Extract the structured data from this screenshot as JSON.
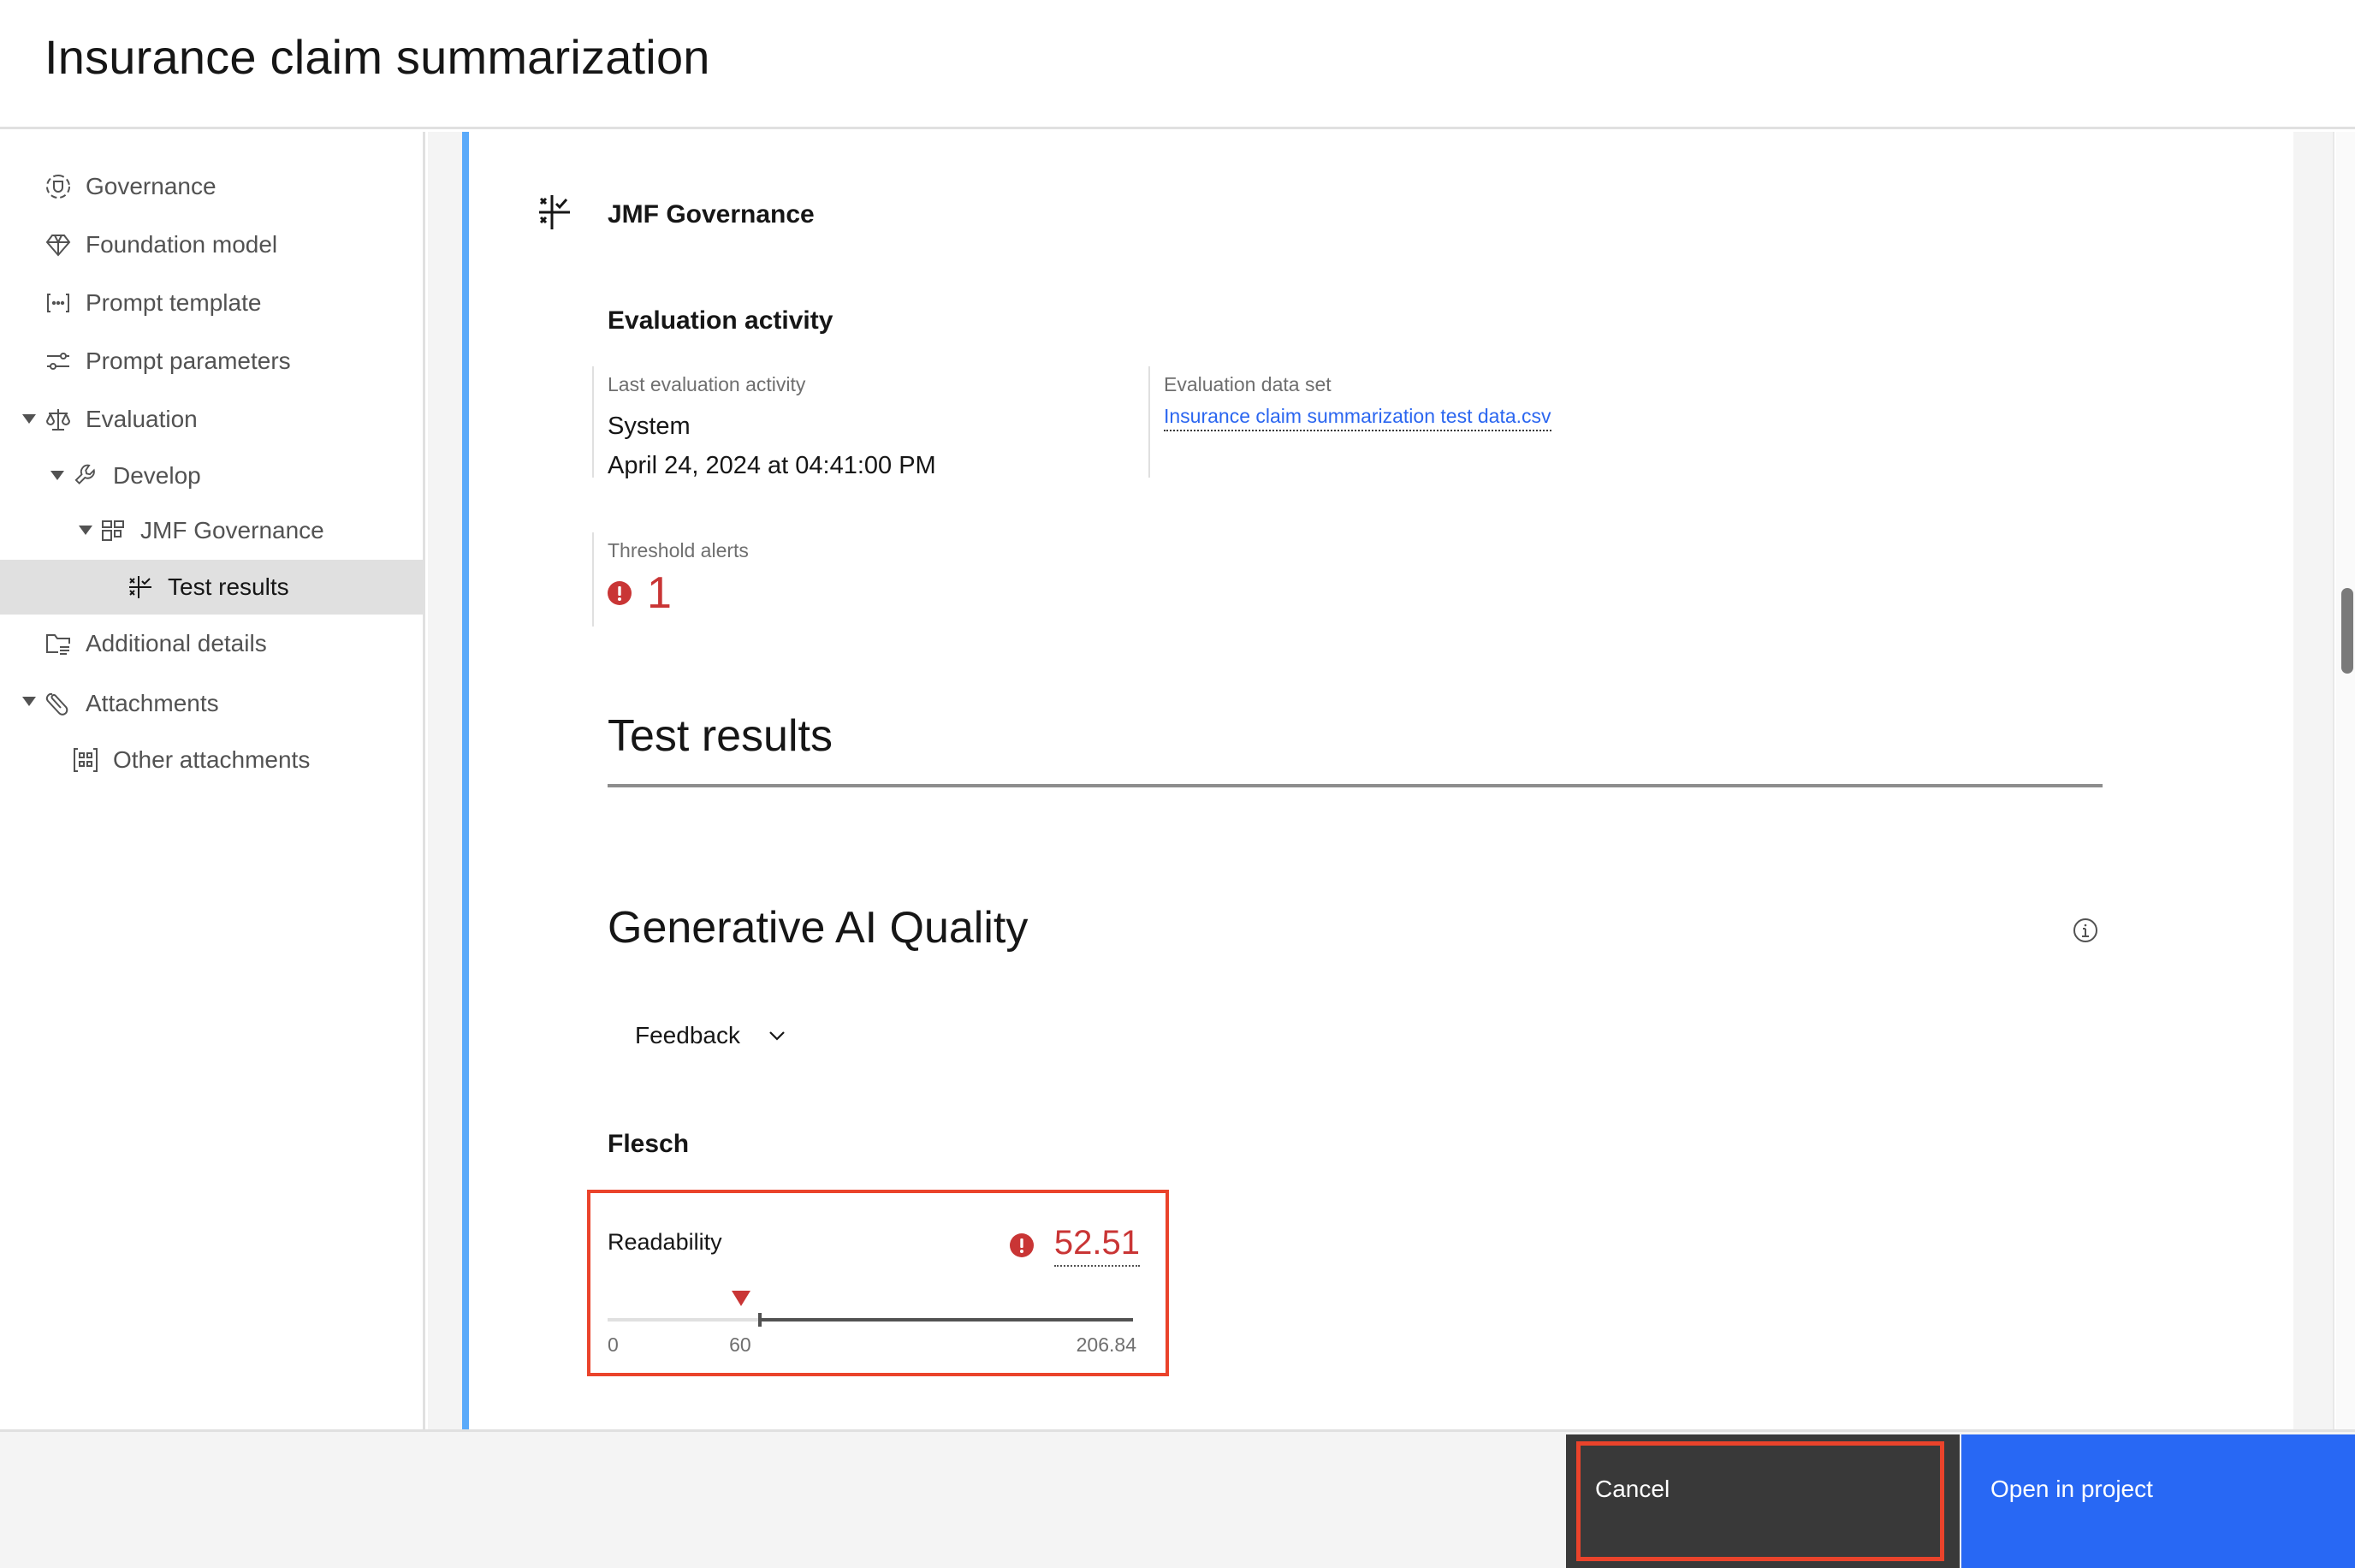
{
  "header": {
    "title": "Insurance claim summarization"
  },
  "sidebar": {
    "items": [
      {
        "label": "Governance",
        "icon": "governance-icon"
      },
      {
        "label": "Foundation model",
        "icon": "diamond-icon"
      },
      {
        "label": "Prompt template",
        "icon": "bracket-dots-icon"
      },
      {
        "label": "Prompt parameters",
        "icon": "sliders-icon"
      },
      {
        "label": "Evaluation",
        "icon": "scales-icon",
        "expanded": true
      },
      {
        "label": "Develop",
        "icon": "wrench-icon",
        "expanded": true
      },
      {
        "label": "JMF Governance",
        "icon": "dashboard-icon",
        "expanded": true
      },
      {
        "label": "Test results",
        "icon": "test-results-icon",
        "active": true
      },
      {
        "label": "Additional details",
        "icon": "folder-details-icon"
      },
      {
        "label": "Attachments",
        "icon": "paperclip-icon",
        "expanded": true
      },
      {
        "label": "Other attachments",
        "icon": "grid-bracket-icon"
      }
    ]
  },
  "main": {
    "section_title": "JMF Governance",
    "evaluation_activity": {
      "heading": "Evaluation activity",
      "last_activity_label": "Last evaluation activity",
      "last_activity_by": "System",
      "last_activity_time": "April 24, 2024 at 04:41:00 PM",
      "dataset_label": "Evaluation data set",
      "dataset_link": "Insurance claim summarization test data.csv",
      "threshold_label": "Threshold alerts",
      "threshold_count": "1"
    },
    "test_results_title": "Test results",
    "genai_title": "Generative AI Quality",
    "feedback_dropdown": {
      "selected": "Feedback"
    },
    "flesch": {
      "heading": "Flesch",
      "metric": {
        "name": "Readability",
        "value": "52.51",
        "value_num": 52.51,
        "threshold": 60,
        "min": 0,
        "max": 206.84,
        "min_label": "0",
        "threshold_label": "60",
        "max_label": "206.84",
        "status": "alert"
      }
    }
  },
  "footer": {
    "cancel_label": "Cancel",
    "open_label": "Open in project"
  },
  "colors": {
    "accent_blue": "#2868f4",
    "alert_red": "#c93535",
    "highlight_red": "#ea432b",
    "link_blue": "#2b66f0",
    "left_accent_line": "#5aaafa"
  }
}
